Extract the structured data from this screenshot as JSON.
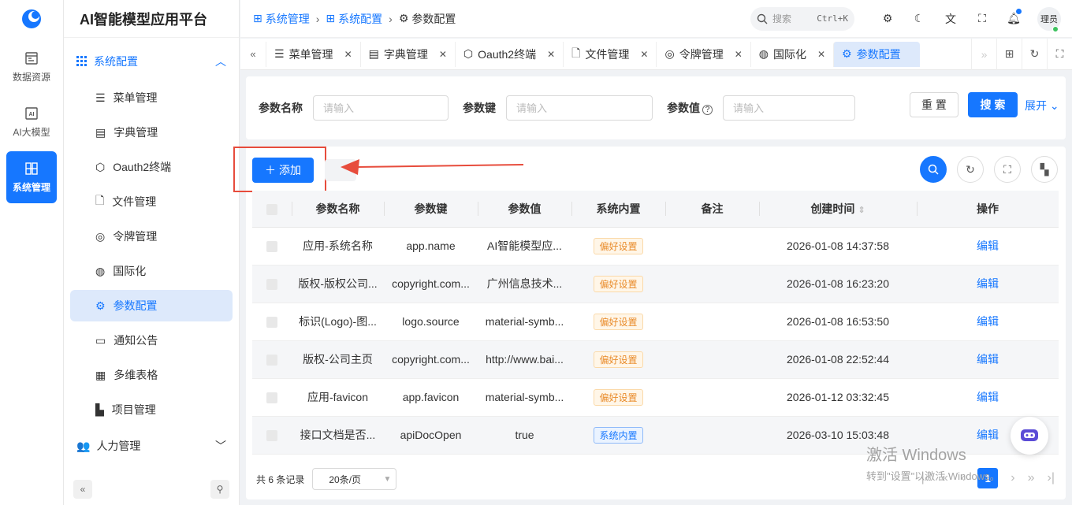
{
  "rail": {
    "items": [
      {
        "label": "数据资源"
      },
      {
        "label": "AI大模型"
      },
      {
        "label": "系统管理"
      }
    ]
  },
  "sidebar": {
    "brand": "AI智能模型应用平台",
    "group": "系统配置",
    "items": [
      {
        "label": "菜单管理"
      },
      {
        "label": "字典管理"
      },
      {
        "label": "Oauth2终端"
      },
      {
        "label": "文件管理"
      },
      {
        "label": "令牌管理"
      },
      {
        "label": "国际化"
      },
      {
        "label": "参数配置"
      },
      {
        "label": "通知公告"
      },
      {
        "label": "多维表格"
      },
      {
        "label": "项目管理"
      }
    ],
    "group2": "人力管理"
  },
  "header": {
    "crumbs": [
      "系统管理",
      "系统配置",
      "参数配置"
    ],
    "search_placeholder": "搜索",
    "shortcut": "Ctrl+K",
    "avatar": "理员"
  },
  "tabs": [
    {
      "label": "菜单管理"
    },
    {
      "label": "字典管理"
    },
    {
      "label": "Oauth2终端"
    },
    {
      "label": "文件管理"
    },
    {
      "label": "令牌管理"
    },
    {
      "label": "国际化"
    },
    {
      "label": "参数配置"
    }
  ],
  "search": {
    "name_label": "参数名称",
    "key_label": "参数键",
    "value_label": "参数值",
    "placeholder": "请输入",
    "reset": "重 置",
    "submit": "搜 索",
    "expand": "展开"
  },
  "toolbar": {
    "add": "添加"
  },
  "table": {
    "columns": [
      "参数名称",
      "参数键",
      "参数值",
      "系统内置",
      "备注",
      "创建时间",
      "操作"
    ],
    "rows": [
      {
        "name": "应用-系统名称",
        "key": "app.name",
        "value": "AI智能模型应...",
        "builtin": "偏好设置",
        "type": "pref",
        "remark": "",
        "created": "2026-01-08 14:37:58",
        "action": "编辑"
      },
      {
        "name": "版权-版权公司...",
        "key": "copyright.com...",
        "value": "广州信息技术...",
        "builtin": "偏好设置",
        "type": "pref",
        "remark": "",
        "created": "2026-01-08 16:23:20",
        "action": "编辑"
      },
      {
        "name": "标识(Logo)-图...",
        "key": "logo.source",
        "value": "material-symb...",
        "builtin": "偏好设置",
        "type": "pref",
        "remark": "",
        "created": "2026-01-08 16:53:50",
        "action": "编辑"
      },
      {
        "name": "版权-公司主页",
        "key": "copyright.com...",
        "value": "http://www.bai...",
        "builtin": "偏好设置",
        "type": "pref",
        "remark": "",
        "created": "2026-01-08 22:52:44",
        "action": "编辑"
      },
      {
        "name": "应用-favicon",
        "key": "app.favicon",
        "value": "material-symb...",
        "builtin": "偏好设置",
        "type": "pref",
        "remark": "",
        "created": "2026-01-12 03:32:45",
        "action": "编辑"
      },
      {
        "name": "接口文档是否...",
        "key": "apiDocOpen",
        "value": "true",
        "builtin": "系统内置",
        "type": "sys",
        "remark": "",
        "created": "2026-03-10 15:03:48",
        "action": "编辑"
      }
    ]
  },
  "footer": {
    "total": "共 6 条记录",
    "page_size": "20条/页",
    "current_page": "1"
  },
  "watermark": {
    "line1": "激活 Windows",
    "line2": "转到\"设置\"以激活 Windows。"
  }
}
